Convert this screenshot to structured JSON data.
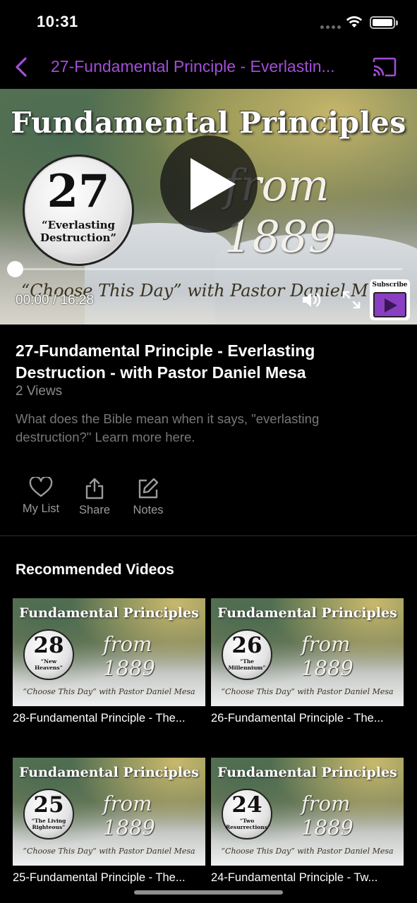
{
  "status_bar": {
    "time": "10:31"
  },
  "nav": {
    "title": "27-Fundamental Principle - Everlastin...",
    "accent_color": "#a14fd6"
  },
  "player": {
    "heading": "Fundamental Principles",
    "script": "from 1889",
    "episode_number": "27",
    "episode_subtitle": "“Everlasting Destruction”",
    "tagline": "“Choose This Day” with Pastor Daniel M",
    "current_time": "00:00",
    "duration": "16:28",
    "time_separator": " / ",
    "progress": 0,
    "subscribe_label": "Subscribe"
  },
  "video": {
    "title": "27-Fundamental Principle - Everlasting Destruction - with Pastor Daniel Mesa",
    "views": "2 Views",
    "description": "What does the Bible mean when it says, \"everlasting destruction?\" Learn more here."
  },
  "actions": [
    {
      "label": "My List",
      "icon": "heart-icon"
    },
    {
      "label": "Share",
      "icon": "share-icon"
    },
    {
      "label": "Notes",
      "icon": "edit-icon"
    }
  ],
  "recommended": {
    "heading": "Recommended Videos",
    "thumb_heading": "Fundamental Principles",
    "thumb_script": "from 1889",
    "thumb_tagline": "“Choose This Day” with Pastor Daniel Mesa",
    "items": [
      {
        "number": "28",
        "subtitle": "“New Heavens”",
        "title": "28-Fundamental Principle - The..."
      },
      {
        "number": "26",
        "subtitle": "“The Millennium”",
        "title": "26-Fundamental Principle - The..."
      },
      {
        "number": "25",
        "subtitle": "“The Living Righteous”",
        "title": "25-Fundamental Principle - The..."
      },
      {
        "number": "24",
        "subtitle": "“Two Resurrections”",
        "title": "24-Fundamental Principle - Tw..."
      }
    ]
  }
}
